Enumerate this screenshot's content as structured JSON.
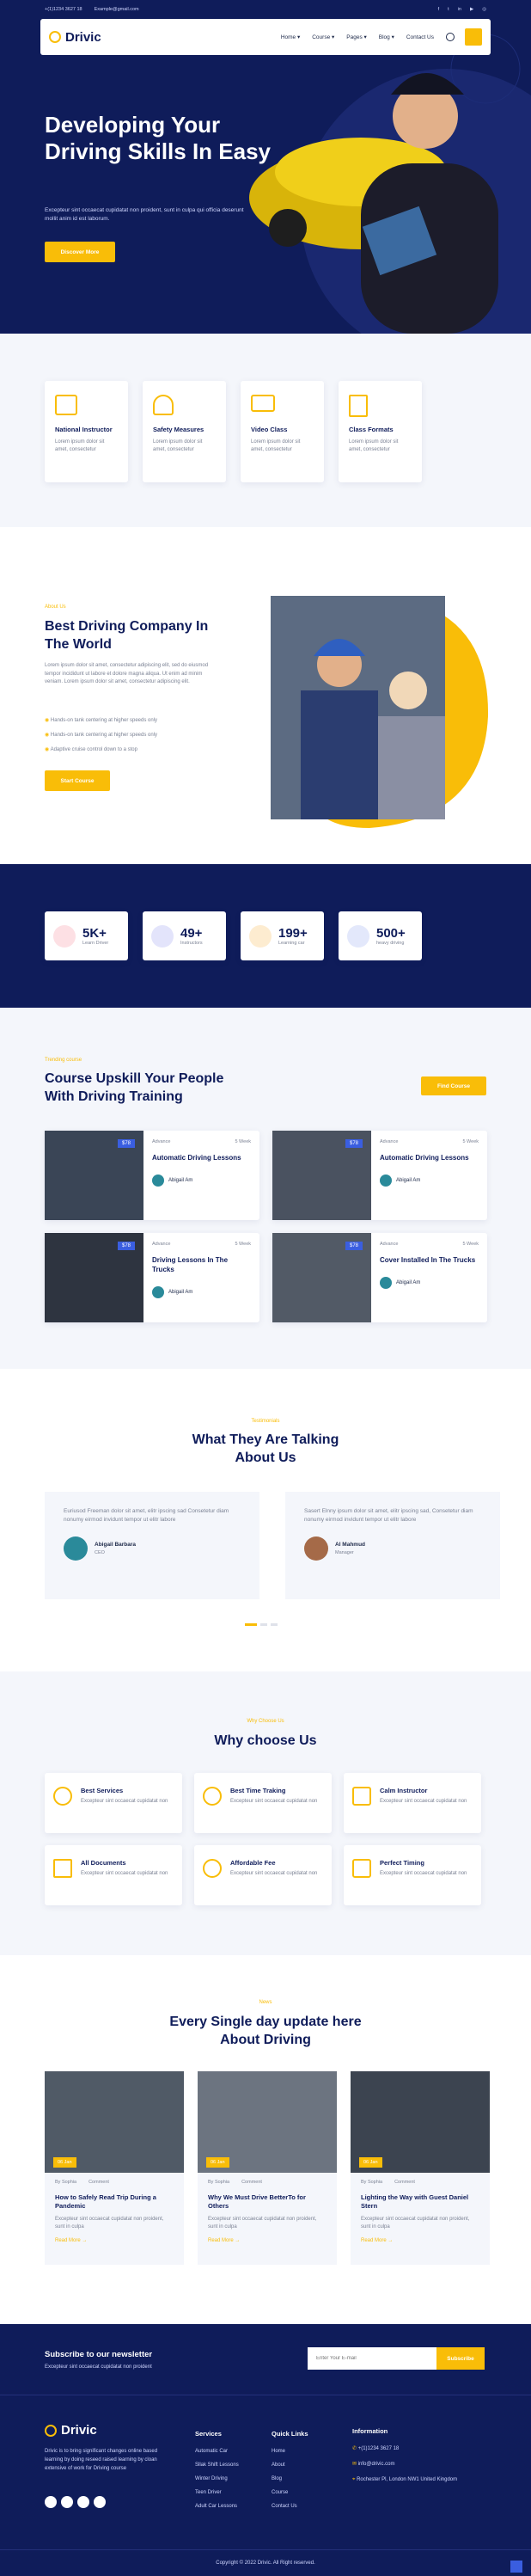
{
  "topbar": {
    "phone": "+(1)1234 3627 18",
    "email": "Example@gmail.com"
  },
  "nav": {
    "brand": "Drivic",
    "items": [
      "Home ▾",
      "Course ▾",
      "Pages ▾",
      "Blog ▾",
      "Contact Us"
    ]
  },
  "hero": {
    "title": "Developing Your Driving Skills In Easy",
    "text": "Excepteur sint occaecat cupidatat non proident, sunt in culpa qui officia deserunt mollit anim id est laborum.",
    "button": "Discover More"
  },
  "features": [
    {
      "title": "National Instructor",
      "text": "Lorem ipsum dolor sit amet, consectetur"
    },
    {
      "title": "Safety Measures",
      "text": "Lorem ipsum dolor sit amet, consectetur"
    },
    {
      "title": "Video Class",
      "text": "Lorem ipsum dolor sit amet, consectetur"
    },
    {
      "title": "Class Formats",
      "text": "Lorem ipsum dolor sit amet, consectetur"
    }
  ],
  "about": {
    "tag": "About Us",
    "title": "Best Driving Company In The World",
    "text": "Lorem ipsum dolor sit amet, consectetur adipiscing elit, sed do eiusmod tempor incididunt ut labore et dolore magna aliqua. Ut enim ad minim veniam. Lorem ipsum dolor sit amet, consectetur adipiscing elit.",
    "list": [
      "Hands-on tank centering at higher speeds only",
      "Hands-on tank centering at higher speeds only",
      "Adaptive cruise control down to a stop"
    ],
    "button": "Start Course"
  },
  "stats": [
    {
      "value": "5K+",
      "label": "Learn Driver"
    },
    {
      "value": "49+",
      "label": "Instructors"
    },
    {
      "value": "199+",
      "label": "Learning car"
    },
    {
      "value": "500+",
      "label": "heavy driving"
    }
  ],
  "courses": {
    "tag": "Trending course",
    "title": "Course Upskill Your People With Driving Training",
    "button": "Find Course",
    "items": [
      {
        "price": "$78",
        "level": "Advance",
        "weeks": "5 Week",
        "title": "Automatic Driving Lessons",
        "author": "Abigail Am"
      },
      {
        "price": "$78",
        "level": "Advance",
        "weeks": "5 Week",
        "title": "Automatic Driving Lessons",
        "author": "Abigail Am"
      },
      {
        "price": "$78",
        "level": "Advance",
        "weeks": "5 Week",
        "title": "Driving Lessons In The Trucks",
        "author": "Abigail Am"
      },
      {
        "price": "$78",
        "level": "Advance",
        "weeks": "5 Week",
        "title": "Cover Installed In The Trucks",
        "author": "Abigail Am"
      }
    ]
  },
  "testimonials": {
    "tag": "Testimonials",
    "title": "What They Are Talking About Us",
    "items": [
      {
        "text": "Euriusod Freeman dolor sit amet, elitr ipscing sad Consetetur diam nonumy eirmod invidunt tempor ut elitr labore",
        "name": "Abigail Barbara",
        "role": "CEO"
      },
      {
        "text": "Sasert Elnny ipsum dolor sit amet, elitr ipscing sad, Consetetur diam nonumy eirmod invidunt tempor ut elitr labore",
        "name": "Al Mahmud",
        "role": "Manager"
      }
    ]
  },
  "why": {
    "tag": "Why Choose Us",
    "title": "Why choose Us",
    "items": [
      {
        "title": "Best Services",
        "text": "Excepteur sint occaecat cupidatat non"
      },
      {
        "title": "Best Time Traking",
        "text": "Excepteur sint occaecat cupidatat non"
      },
      {
        "title": "Calm Instructor",
        "text": "Excepteur sint occaecat cupidatat non"
      },
      {
        "title": "All Documents",
        "text": "Excepteur sint occaecat cupidatat non"
      },
      {
        "title": "Affordable Fee",
        "text": "Excepteur sint occaecat cupidatat non"
      },
      {
        "title": "Perfect Timing",
        "text": "Excepteur sint occaecat cupidatat non"
      }
    ]
  },
  "news": {
    "tag": "News",
    "title": "Every Single day update here About Driving",
    "items": [
      {
        "date": "06 Jan",
        "author": "By Sophia",
        "comment": "Comment",
        "title": "How to Safely Read Trip During a Pandemic",
        "text": "Excepteur sint occaecat cupidatat non proident, sunt in culpa",
        "more": "Read More →"
      },
      {
        "date": "06 Jan",
        "author": "By Sophia",
        "comment": "Comment",
        "title": "Why We Must Drive BetterTo for Others",
        "text": "Excepteur sint occaecat cupidatat non proident, sunt in culpa",
        "more": "Read More →"
      },
      {
        "date": "06 Jan",
        "author": "By Sophia",
        "comment": "Comment",
        "title": "Lighting the Way with Guest Daniel Stern",
        "text": "Excepteur sint occaecat cupidatat non proident, sunt in culpa",
        "more": "Read More →"
      }
    ]
  },
  "newsletter": {
    "title": "Subscribe to our newsletter",
    "text": "Excepteur sint occaecat cupidatat non proident",
    "placeholder": "Enter Your E-mail",
    "button": "Subscribe"
  },
  "footer": {
    "brand": "Drivic",
    "about": "Drivic is to bring significant changes online based learning by doing reseed raised learning by cloan extensive of work for Driving course",
    "services_title": "Services",
    "services": [
      "Automatic Car",
      "Sllak Shift Lessons",
      "Winter Driving",
      "Teen Driver",
      "Adult Car Lessons"
    ],
    "links_title": "Quick Links",
    "links": [
      "Home",
      "About",
      "Blog",
      "Course",
      "Contact Us"
    ],
    "info_title": "Information",
    "phone": "+(1)1234 3627 18",
    "email": "info@drivic.com",
    "address": "Rochester Pl, London NW1 United Kingdom",
    "copyright": "Copyright © 2022 Drivic. All Right reserved."
  },
  "colors": {
    "navy": "#0f1c5a",
    "accent": "#f9bd08"
  }
}
